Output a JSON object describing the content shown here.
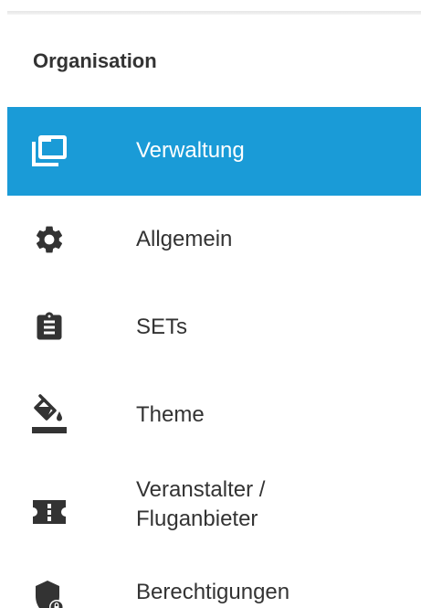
{
  "sidebar": {
    "section_title": "Organisation",
    "items": [
      {
        "label": "Verwaltung",
        "icon": "folders-icon",
        "active": true
      },
      {
        "label": "Allgemein",
        "icon": "gear-icon",
        "active": false
      },
      {
        "label": "SETs",
        "icon": "clipboard-icon",
        "active": false
      },
      {
        "label": "Theme",
        "icon": "paint-bucket-icon",
        "active": false
      },
      {
        "label": "Veranstalter /\nFluganbieter",
        "icon": "ticket-icon",
        "active": false
      },
      {
        "label": "Berechtigungen",
        "icon": "shield-lock-icon",
        "active": false
      }
    ]
  },
  "colors": {
    "active_background": "#1a9bd7",
    "active_text": "#ffffff",
    "text": "#333333"
  }
}
